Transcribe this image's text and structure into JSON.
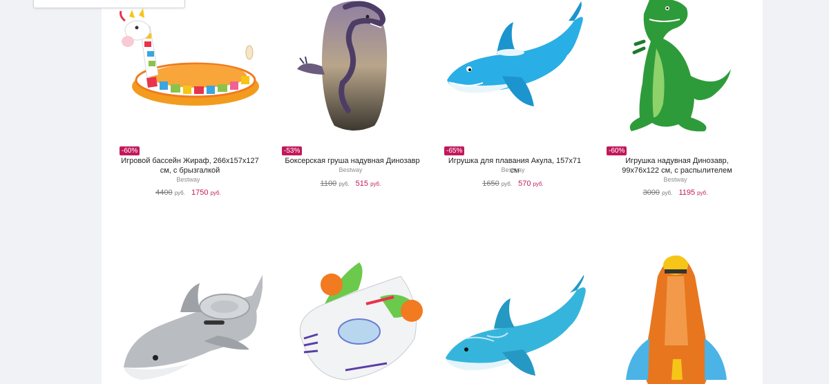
{
  "products": [
    {
      "discount": "-60%",
      "title": "Игровой бассейн Жираф, 266х157х127 см, с брызгалкой",
      "brand": "Bestway",
      "old_price": "4400",
      "price": "1750",
      "currency": "руб.",
      "image_icon": "giraffe-pool-icon"
    },
    {
      "discount": "-53%",
      "title": "Боксерская груша надувная Динозавр",
      "brand": "Bestway",
      "old_price": "1100",
      "price": "515",
      "currency": "руб.",
      "image_icon": "dinosaur-punching-bag-icon"
    },
    {
      "discount": "-65%",
      "title": "Игрушка для плавания Акула, 157х71 см",
      "brand": "Bestway",
      "old_price": "1650",
      "price": "570",
      "currency": "руб.",
      "image_icon": "shark-rider-icon"
    },
    {
      "discount": "-60%",
      "title": "Игрушка надувная Динозавр, 99х76х122 см, с распылителем",
      "brand": "Bestway",
      "old_price": "3000",
      "price": "1195",
      "currency": "руб.",
      "image_icon": "trex-sprinkler-icon"
    },
    {
      "image_icon": "grey-shark-float-icon"
    },
    {
      "image_icon": "buzz-spaceship-float-icon"
    },
    {
      "image_icon": "blue-shark-rider-icon"
    },
    {
      "image_icon": "rocket-float-icon"
    }
  ],
  "colors": {
    "background": "#f1f2f6",
    "card": "#ffffff",
    "discount_badge": "#c2185b",
    "price_accent": "#c2185b",
    "old_price": "#777777"
  }
}
